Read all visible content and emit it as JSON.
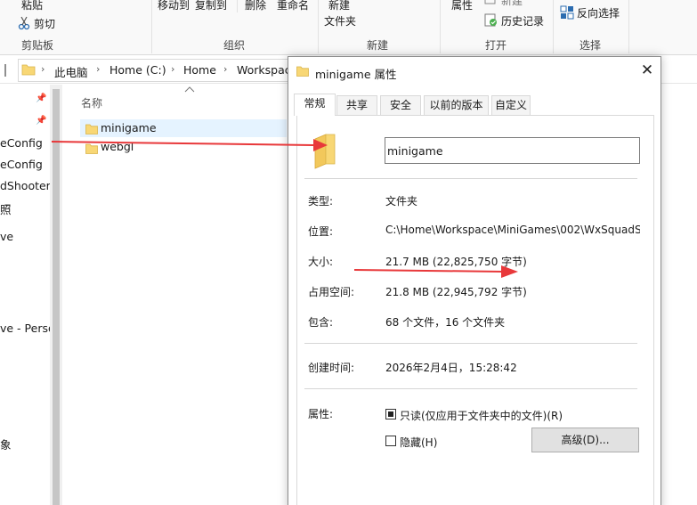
{
  "ribbon": {
    "paste": "粘贴",
    "cut": "剪切",
    "move_to": "移动到",
    "copy_to": "复制到",
    "delete": "删除",
    "rename": "重命名",
    "new_item": "新建",
    "new_folder": "文件夹",
    "properties": "属性",
    "history": "历史记录",
    "invert_selection": "反向选择",
    "partial_top": "新建",
    "groups": {
      "clipboard": "剪贴板",
      "organize": "组织",
      "new": "新建",
      "open": "打开",
      "select": "选择"
    }
  },
  "address": {
    "crumbs": [
      "此电脑",
      "Home (C:)",
      "Home",
      "Workspac"
    ]
  },
  "nav": {
    "items": [
      "eConfig",
      "eConfig",
      "dShooter",
      "照",
      "ve",
      "ve - Perso",
      "象"
    ]
  },
  "files": {
    "column_name": "名称",
    "rows": [
      {
        "name": "minigame",
        "selected": true
      },
      {
        "name": "webgl",
        "selected": false
      }
    ]
  },
  "dialog": {
    "title": "minigame 属性",
    "tabs": [
      "常规",
      "共享",
      "安全",
      "以前的版本",
      "自定义"
    ],
    "active_tab": "常规",
    "folder_name": "minigame",
    "fields": {
      "type_label": "类型:",
      "type_value": "文件夹",
      "location_label": "位置:",
      "location_value": "C:\\Home\\Workspace\\MiniGames\\002\\WxSquadS",
      "size_label": "大小:",
      "size_value": "21.7 MB (22,825,750 字节)",
      "disk_label": "占用空间:",
      "disk_value": "21.8 MB (22,945,792 字节)",
      "contains_label": "包含:",
      "contains_value": "68 个文件，16 个文件夹",
      "created_label": "创建时间:",
      "created_value": "2026年2月4日，15:28:42",
      "attr_label": "属性:"
    },
    "readonly_label": "只读(仅应用于文件夹中的文件)(R)",
    "hidden_label": "隐藏(H)",
    "advanced_button": "高级(D)..."
  },
  "colors": {
    "arrow": "#e8383a",
    "folder": "#f8d775",
    "selection": "#e5f3ff"
  }
}
